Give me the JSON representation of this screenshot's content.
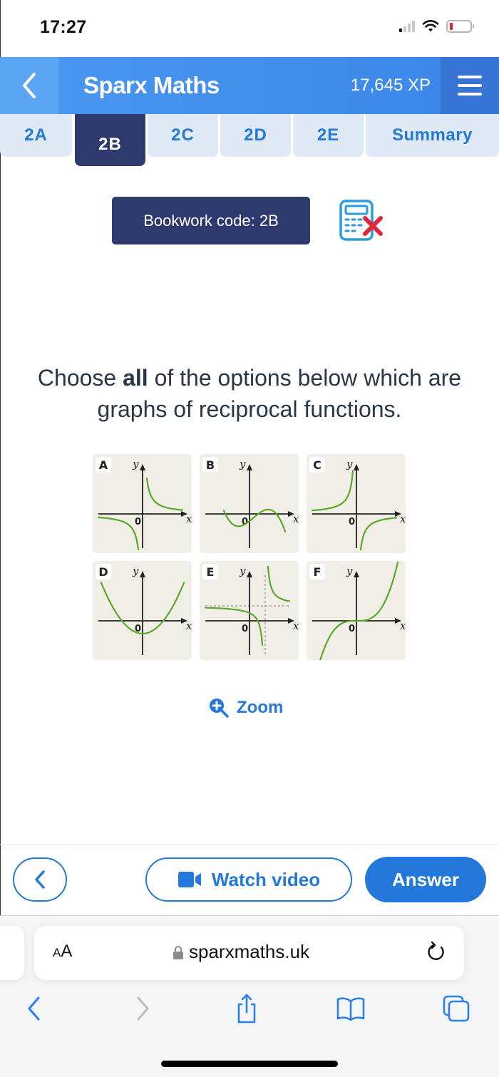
{
  "status_bar": {
    "time": "17:27",
    "icons": [
      "signal-icon",
      "wifi-icon",
      "battery-low-icon"
    ]
  },
  "header": {
    "back_icon": "chevron-left-icon",
    "title": "Sparx Maths",
    "xp": "17,645 XP",
    "menu_icon": "hamburger-menu-icon"
  },
  "tabs": [
    {
      "label": "2A",
      "active": false
    },
    {
      "label": "2B",
      "active": true
    },
    {
      "label": "2C",
      "active": false
    },
    {
      "label": "2D",
      "active": false
    },
    {
      "label": "2E",
      "active": false
    },
    {
      "label": "Summary",
      "active": false
    }
  ],
  "bookwork": {
    "label": "Bookwork code: 2B",
    "calculator_icon": "calculator-not-allowed-icon"
  },
  "question": {
    "prefix": "Choose ",
    "emphasis": "all",
    "suffix": " of the options below which are graphs of reciprocal functions."
  },
  "graphs": [
    {
      "label": "A",
      "description": "reciprocal curve in quadrants 1 and 3",
      "axis_x": "x",
      "axis_y": "y",
      "origin": "0"
    },
    {
      "label": "B",
      "description": "negative cubic with two turning points",
      "axis_x": "x",
      "axis_y": "y",
      "origin": "0"
    },
    {
      "label": "C",
      "description": "reciprocal curve in quadrants 2 and 4",
      "axis_x": "x",
      "axis_y": "y",
      "origin": "0"
    },
    {
      "label": "D",
      "description": "upward parabola",
      "axis_x": "x",
      "axis_y": "y",
      "origin": "0"
    },
    {
      "label": "E",
      "description": "translated reciprocal curve with dashed asymptotes",
      "axis_x": "x",
      "axis_y": "y",
      "origin": "0"
    },
    {
      "label": "F",
      "description": "cubic through origin",
      "axis_x": "x",
      "axis_y": "y",
      "origin": "0"
    }
  ],
  "zoom": {
    "label": "Zoom",
    "icon": "zoom-in-icon"
  },
  "actions": {
    "back_icon": "chevron-left-icon",
    "watch_video": "Watch video",
    "video_icon": "video-camera-icon",
    "answer": "Answer"
  },
  "browser": {
    "text_size": "AA",
    "url": "sparxmaths.uk",
    "lock_icon": "lock-icon",
    "reload_icon": "reload-icon",
    "nav_icons": [
      "back-icon",
      "forward-icon",
      "share-icon",
      "bookmarks-icon",
      "tabs-icon"
    ]
  },
  "colors": {
    "accent": "#2478d9",
    "header": "#3b86e8",
    "active_tab": "#2e3a6e",
    "curve": "#5aaa2a",
    "graph_bg": "#f1eee8"
  }
}
